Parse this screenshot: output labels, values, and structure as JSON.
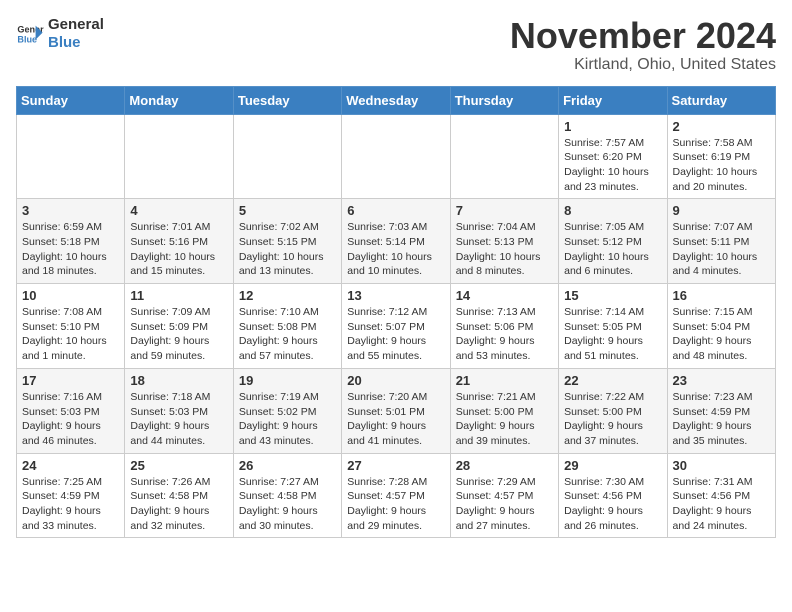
{
  "header": {
    "logo_general": "General",
    "logo_blue": "Blue",
    "month_title": "November 2024",
    "location": "Kirtland, Ohio, United States"
  },
  "days_of_week": [
    "Sunday",
    "Monday",
    "Tuesday",
    "Wednesday",
    "Thursday",
    "Friday",
    "Saturday"
  ],
  "weeks": [
    [
      {
        "day": "",
        "detail": ""
      },
      {
        "day": "",
        "detail": ""
      },
      {
        "day": "",
        "detail": ""
      },
      {
        "day": "",
        "detail": ""
      },
      {
        "day": "",
        "detail": ""
      },
      {
        "day": "1",
        "detail": "Sunrise: 7:57 AM\nSunset: 6:20 PM\nDaylight: 10 hours and 23 minutes."
      },
      {
        "day": "2",
        "detail": "Sunrise: 7:58 AM\nSunset: 6:19 PM\nDaylight: 10 hours and 20 minutes."
      }
    ],
    [
      {
        "day": "3",
        "detail": "Sunrise: 6:59 AM\nSunset: 5:18 PM\nDaylight: 10 hours and 18 minutes."
      },
      {
        "day": "4",
        "detail": "Sunrise: 7:01 AM\nSunset: 5:16 PM\nDaylight: 10 hours and 15 minutes."
      },
      {
        "day": "5",
        "detail": "Sunrise: 7:02 AM\nSunset: 5:15 PM\nDaylight: 10 hours and 13 minutes."
      },
      {
        "day": "6",
        "detail": "Sunrise: 7:03 AM\nSunset: 5:14 PM\nDaylight: 10 hours and 10 minutes."
      },
      {
        "day": "7",
        "detail": "Sunrise: 7:04 AM\nSunset: 5:13 PM\nDaylight: 10 hours and 8 minutes."
      },
      {
        "day": "8",
        "detail": "Sunrise: 7:05 AM\nSunset: 5:12 PM\nDaylight: 10 hours and 6 minutes."
      },
      {
        "day": "9",
        "detail": "Sunrise: 7:07 AM\nSunset: 5:11 PM\nDaylight: 10 hours and 4 minutes."
      }
    ],
    [
      {
        "day": "10",
        "detail": "Sunrise: 7:08 AM\nSunset: 5:10 PM\nDaylight: 10 hours and 1 minute."
      },
      {
        "day": "11",
        "detail": "Sunrise: 7:09 AM\nSunset: 5:09 PM\nDaylight: 9 hours and 59 minutes."
      },
      {
        "day": "12",
        "detail": "Sunrise: 7:10 AM\nSunset: 5:08 PM\nDaylight: 9 hours and 57 minutes."
      },
      {
        "day": "13",
        "detail": "Sunrise: 7:12 AM\nSunset: 5:07 PM\nDaylight: 9 hours and 55 minutes."
      },
      {
        "day": "14",
        "detail": "Sunrise: 7:13 AM\nSunset: 5:06 PM\nDaylight: 9 hours and 53 minutes."
      },
      {
        "day": "15",
        "detail": "Sunrise: 7:14 AM\nSunset: 5:05 PM\nDaylight: 9 hours and 51 minutes."
      },
      {
        "day": "16",
        "detail": "Sunrise: 7:15 AM\nSunset: 5:04 PM\nDaylight: 9 hours and 48 minutes."
      }
    ],
    [
      {
        "day": "17",
        "detail": "Sunrise: 7:16 AM\nSunset: 5:03 PM\nDaylight: 9 hours and 46 minutes."
      },
      {
        "day": "18",
        "detail": "Sunrise: 7:18 AM\nSunset: 5:03 PM\nDaylight: 9 hours and 44 minutes."
      },
      {
        "day": "19",
        "detail": "Sunrise: 7:19 AM\nSunset: 5:02 PM\nDaylight: 9 hours and 43 minutes."
      },
      {
        "day": "20",
        "detail": "Sunrise: 7:20 AM\nSunset: 5:01 PM\nDaylight: 9 hours and 41 minutes."
      },
      {
        "day": "21",
        "detail": "Sunrise: 7:21 AM\nSunset: 5:00 PM\nDaylight: 9 hours and 39 minutes."
      },
      {
        "day": "22",
        "detail": "Sunrise: 7:22 AM\nSunset: 5:00 PM\nDaylight: 9 hours and 37 minutes."
      },
      {
        "day": "23",
        "detail": "Sunrise: 7:23 AM\nSunset: 4:59 PM\nDaylight: 9 hours and 35 minutes."
      }
    ],
    [
      {
        "day": "24",
        "detail": "Sunrise: 7:25 AM\nSunset: 4:59 PM\nDaylight: 9 hours and 33 minutes."
      },
      {
        "day": "25",
        "detail": "Sunrise: 7:26 AM\nSunset: 4:58 PM\nDaylight: 9 hours and 32 minutes."
      },
      {
        "day": "26",
        "detail": "Sunrise: 7:27 AM\nSunset: 4:58 PM\nDaylight: 9 hours and 30 minutes."
      },
      {
        "day": "27",
        "detail": "Sunrise: 7:28 AM\nSunset: 4:57 PM\nDaylight: 9 hours and 29 minutes."
      },
      {
        "day": "28",
        "detail": "Sunrise: 7:29 AM\nSunset: 4:57 PM\nDaylight: 9 hours and 27 minutes."
      },
      {
        "day": "29",
        "detail": "Sunrise: 7:30 AM\nSunset: 4:56 PM\nDaylight: 9 hours and 26 minutes."
      },
      {
        "day": "30",
        "detail": "Sunrise: 7:31 AM\nSunset: 4:56 PM\nDaylight: 9 hours and 24 minutes."
      }
    ]
  ]
}
